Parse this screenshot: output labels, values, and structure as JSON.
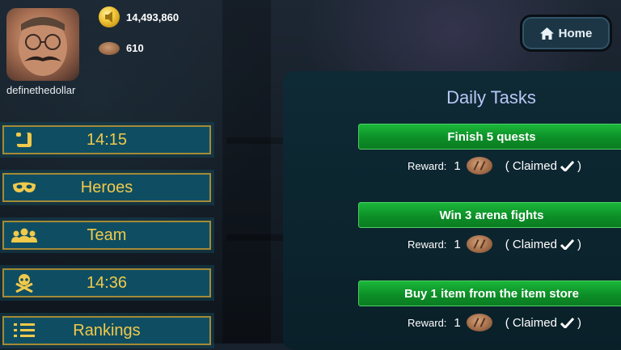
{
  "profile": {
    "username": "definethedollar",
    "coins": "14,493,860",
    "bread": "610"
  },
  "menu": [
    {
      "label": "14:15",
      "icon": "scroll-icon"
    },
    {
      "label": "Heroes",
      "icon": "mask-icon"
    },
    {
      "label": "Team",
      "icon": "team-icon"
    },
    {
      "label": "14:36",
      "icon": "skull-crossbones-icon"
    },
    {
      "label": "Rankings",
      "icon": "ranked-list-icon"
    }
  ],
  "home": {
    "label": "Home",
    "icon": "home-icon"
  },
  "daily_tasks": {
    "title": "Daily Tasks",
    "reward_label": "Reward:",
    "tasks": [
      {
        "name": "Finish 5 quests",
        "reward_count": "1",
        "status_open": "( Claimed",
        "status_close": ")"
      },
      {
        "name": "Win 3 arena fights",
        "reward_count": "1",
        "status_open": "( Claimed",
        "status_close": ")"
      },
      {
        "name": "Buy 1 item from the item store",
        "reward_count": "1",
        "status_open": "( Claimed",
        "status_close": ")"
      }
    ]
  },
  "colors": {
    "menu_bg": "#0f4e62",
    "menu_border": "#a48a37",
    "menu_text": "#f1c94b",
    "task_green": "#0c8f27",
    "title_text": "#b9c7f5"
  }
}
